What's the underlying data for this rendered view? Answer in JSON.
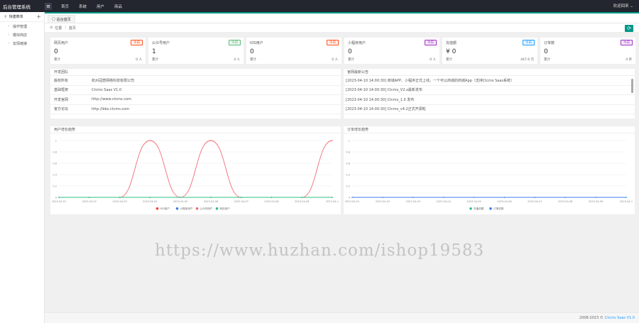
{
  "app": {
    "title": "后台管理系统",
    "menu_icon": "hamburger-icon"
  },
  "top_nav": [
    "首页",
    "系统",
    "用户",
    "商品"
  ],
  "user": {
    "label": "欢迎回来"
  },
  "sidebar": {
    "header": "快捷菜单",
    "plus": "+",
    "items": [
      {
        "label": "操作管理"
      },
      {
        "label": "模块商店"
      },
      {
        "label": "友情链接"
      }
    ]
  },
  "tab": {
    "label": "后台首页"
  },
  "breadcrumb": {
    "location": "位置",
    "sep": "/",
    "current": "首页"
  },
  "cards": [
    {
      "title": "网页用户",
      "badge": "今日",
      "badge_color": "#ff5722",
      "badge_bg": "#ffeee8",
      "value": "0",
      "foot_label": "累计",
      "foot_value": "0 人"
    },
    {
      "title": "公众号用户",
      "badge": "今日",
      "badge_color": "#5fb878",
      "badge_bg": "#eaf6ee",
      "value": "1",
      "foot_label": "累计",
      "foot_value": "4 人"
    },
    {
      "title": "IOS用户",
      "badge": "今日",
      "badge_color": "#ff5722",
      "badge_bg": "#ffeee8",
      "value": "0",
      "foot_label": "累计",
      "foot_value": "0 人"
    },
    {
      "title": "小程序用户",
      "badge": "今日",
      "badge_color": "#a233c6",
      "badge_bg": "#f5e8fa",
      "value": "0",
      "foot_label": "累计",
      "foot_value": "0 人"
    },
    {
      "title": "充值额",
      "badge": "今日",
      "badge_color": "#1e9fff",
      "badge_bg": "#e6f4ff",
      "value": "¥ 0",
      "foot_label": "累计",
      "foot_value": "447.6 元"
    },
    {
      "title": "订单数",
      "badge": "今日",
      "badge_color": "#a233c6",
      "badge_bg": "#f5e8fa",
      "value": "0",
      "foot_label": "累计",
      "foot_value": "4 单"
    }
  ],
  "dev_info": {
    "title": "开发团队",
    "rows": [
      {
        "key": "版权所有",
        "value": "杭州冠唐网络科技有限公司"
      },
      {
        "key": "基础框架",
        "value": "Ctcms Saas V1.0"
      },
      {
        "key": "开发官网",
        "value": "http://www.ctcms.com"
      },
      {
        "key": "官方论坛",
        "value": "http://bbs.ctcms.com"
      }
    ]
  },
  "notices": {
    "title": "官网最新公告",
    "rows": [
      "[2023-04-10 14:00:30] 商城APP、小程序正式上线，一个可以商城的商城App（支持Ctcms Saas系统）",
      "[2023-04-10 14:00:30] Ctcms_V2.x最新发布",
      "[2023-04-10 14:00:30] Ctcms_1.0 发布",
      "[2023-04-10 14:00:30] Ctcms_v4.2正式开源啦"
    ]
  },
  "chart_user": {
    "title": "用户增长趋势",
    "type": "line",
    "x": [
      "2023-04-01",
      "2023-04-02",
      "2023-04-03",
      "2023-04-04",
      "2023-04-05",
      "2023-04-06",
      "2023-04-07",
      "2023-04-08",
      "2023-04-09",
      "2023-04-1"
    ],
    "yticks": [
      "1",
      "0.8",
      "0.6",
      "0.4",
      "0.2",
      "0"
    ],
    "ylim": [
      0,
      1
    ],
    "series": [
      {
        "name": "IOS用户",
        "color": "#ff3b3b",
        "values": [
          0,
          0,
          0,
          0,
          0,
          0,
          0,
          0,
          0,
          0
        ]
      },
      {
        "name": "小程序用户",
        "color": "#3d7ee8",
        "values": [
          0,
          0,
          0,
          0,
          0,
          0,
          0,
          0,
          0,
          0
        ]
      },
      {
        "name": "公众号用户",
        "color": "#f26a72",
        "values": [
          0,
          0,
          0,
          1,
          0,
          1,
          0,
          0,
          0,
          1
        ]
      },
      {
        "name": "网页用户",
        "color": "#2ec27e",
        "values": [
          0,
          0,
          0,
          0,
          0,
          0,
          0,
          0,
          0,
          0
        ]
      }
    ],
    "draw_order": [
      0,
      1,
      2,
      3
    ]
  },
  "chart_order": {
    "title": "订单增长趋势",
    "type": "line",
    "x": [
      "2023-04-01",
      "2023-04-02",
      "2023-04-03",
      "2023-04-04",
      "2023-04-05",
      "2023-04-06",
      "2023-04-07",
      "2023-04-08",
      "2023-04-09",
      "2023-04-1"
    ],
    "yticks": [
      "1",
      "0.8",
      "0.6",
      "0.4",
      "0.2",
      "0"
    ],
    "ylim": [
      0,
      1
    ],
    "series": [
      {
        "name": "充值总额",
        "color": "#2ec27e",
        "values": [
          0,
          0,
          0,
          0,
          0,
          0,
          0,
          0,
          0,
          0
        ]
      },
      {
        "name": "订单总数",
        "color": "#3d7ee8",
        "values": [
          0,
          0,
          0,
          0,
          0,
          0,
          0,
          0,
          0,
          0
        ]
      }
    ],
    "draw_order": [
      0,
      1
    ]
  },
  "footer": {
    "copyright": "2008-2023 ©",
    "version": "Ctcms Saas V1.0"
  },
  "watermark": {
    "text": "https://www.huzhan.com/ishop19583"
  }
}
